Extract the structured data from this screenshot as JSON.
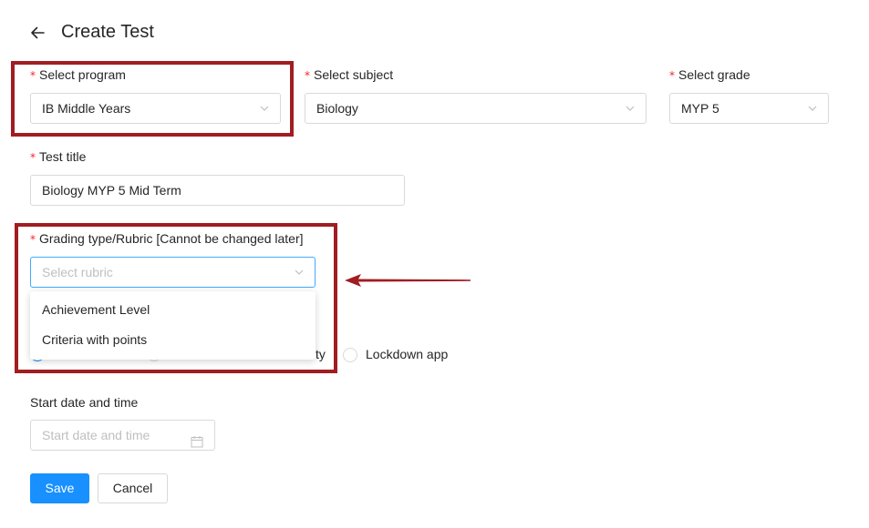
{
  "header": {
    "title": "Create Test",
    "back_icon": "arrow-left-icon"
  },
  "required_mark": "*",
  "program": {
    "label": "Select program",
    "value": "IB Middle Years"
  },
  "subject": {
    "label": "Select subject",
    "value": "Biology"
  },
  "grade": {
    "label": "Select grade",
    "value": "MYP 5"
  },
  "test_title": {
    "label": "Test title",
    "value": "Biology MYP 5 Mid Term"
  },
  "rubric": {
    "label": "Grading type/Rubric [Cannot be changed later]",
    "placeholder": "Select rubric",
    "options": [
      "Achievement Level",
      "Criteria with points"
    ]
  },
  "proctoring": {
    "partial_option_suffix": "ty",
    "lockdown_label": "Lockdown app"
  },
  "start": {
    "label": "Start date and time",
    "placeholder": "Start date and time",
    "icon": "calendar-icon"
  },
  "buttons": {
    "save": "Save",
    "cancel": "Cancel"
  },
  "colors": {
    "primary": "#1890ff",
    "highlight": "#a11d21",
    "required": "#f5222d",
    "border": "#d9d9d9"
  }
}
